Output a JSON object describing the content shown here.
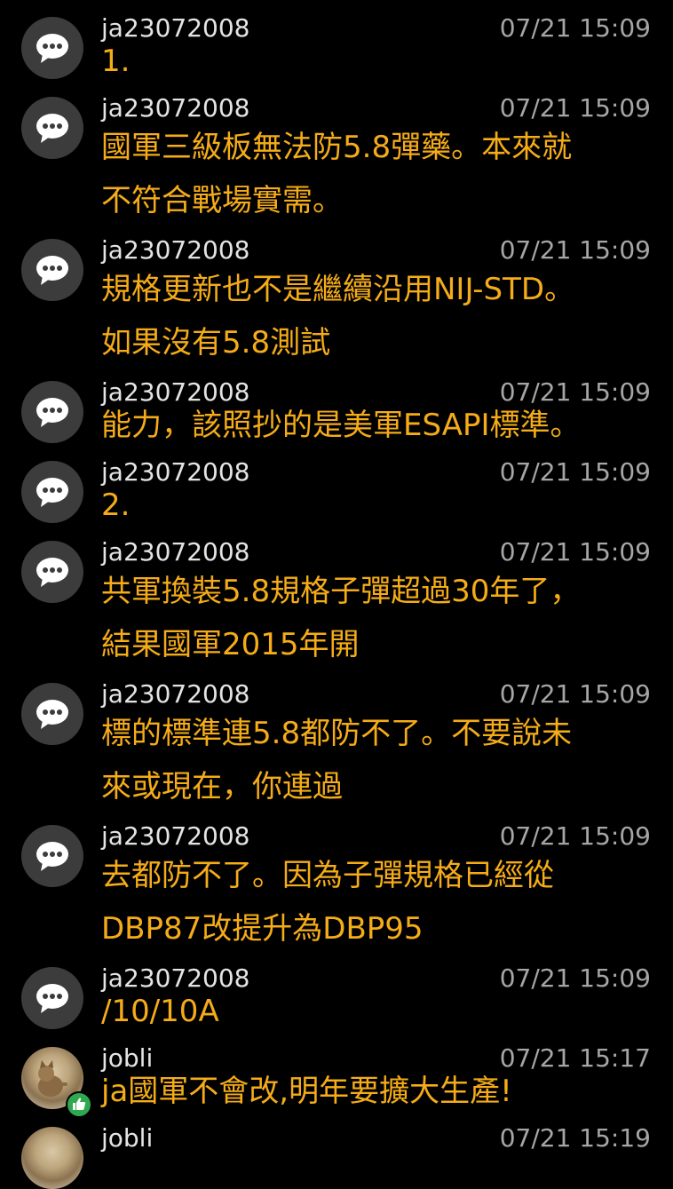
{
  "comments": [
    {
      "user": "ja23072008",
      "time": "07/21 15:09",
      "lines": [
        "1."
      ]
    },
    {
      "user": "ja23072008",
      "time": "07/21 15:09",
      "lines": [
        "國軍三級板無法防5.8彈藥。本來就",
        "不符合戰場實需。"
      ]
    },
    {
      "user": "ja23072008",
      "time": "07/21 15:09",
      "lines": [
        "規格更新也不是繼續沿用NIJ-STD。",
        "如果沒有5.8測試"
      ]
    },
    {
      "user": "ja23072008",
      "time": "07/21 15:09",
      "lines": [
        "能力，該照抄的是美軍ESAPI標準。"
      ]
    },
    {
      "user": "ja23072008",
      "time": "07/21 15:09",
      "lines": [
        "2."
      ]
    },
    {
      "user": "ja23072008",
      "time": "07/21 15:09",
      "lines": [
        "共軍換裝5.8規格子彈超過30年了，",
        "結果國軍2015年開"
      ]
    },
    {
      "user": "ja23072008",
      "time": "07/21 15:09",
      "lines": [
        "標的標準連5.8都防不了。不要說未",
        "來或現在，你連過"
      ]
    },
    {
      "user": "ja23072008",
      "time": "07/21 15:09",
      "lines": [
        "去都防不了。因為子彈規格已經從",
        "DBP87改提升為DBP95"
      ]
    },
    {
      "user": "ja23072008",
      "time": "07/21 15:09",
      "lines": [
        "/10/10A"
      ]
    },
    {
      "user": "jobli",
      "time": "07/21 15:17",
      "lines": [
        "ja國軍不會改,明年要擴大生產!"
      ]
    },
    {
      "user": "jobli",
      "time": "07/21 15:19",
      "lines": []
    }
  ],
  "icons": {
    "default_avatar": "chat-bubble-icon",
    "like_badge": "thumbs-up-icon"
  },
  "colors": {
    "background": "#000000",
    "message_text": "#f5ac18",
    "username": "#e4e4e4",
    "timestamp": "#a6a6a6",
    "avatar_bg": "#3c3c3c",
    "like_badge": "#2fa84f"
  }
}
